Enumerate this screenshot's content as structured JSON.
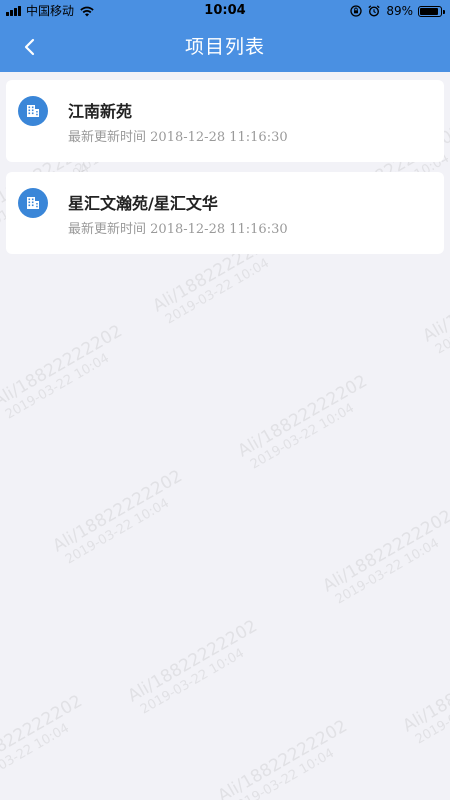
{
  "status_bar": {
    "carrier": "中国移动",
    "time": "10:04",
    "battery_percent_text": "89%",
    "battery_level": 0.89
  },
  "nav": {
    "title": "项目列表"
  },
  "projects": [
    {
      "name": "江南新苑",
      "updated_label": "最新更新时间",
      "updated_time": "2018-12-28 11:16:30"
    },
    {
      "name": "星汇文瀚苑/星汇文华",
      "updated_label": "最新更新时间",
      "updated_time": "2018-12-28 11:16:30"
    }
  ],
  "watermark": {
    "user": "Ali/18822222202",
    "date": "2019-03-22 10:04"
  },
  "colors": {
    "header": "#4a90e2",
    "icon_bg": "#3a86d8",
    "page_bg": "#f2f2f7"
  }
}
